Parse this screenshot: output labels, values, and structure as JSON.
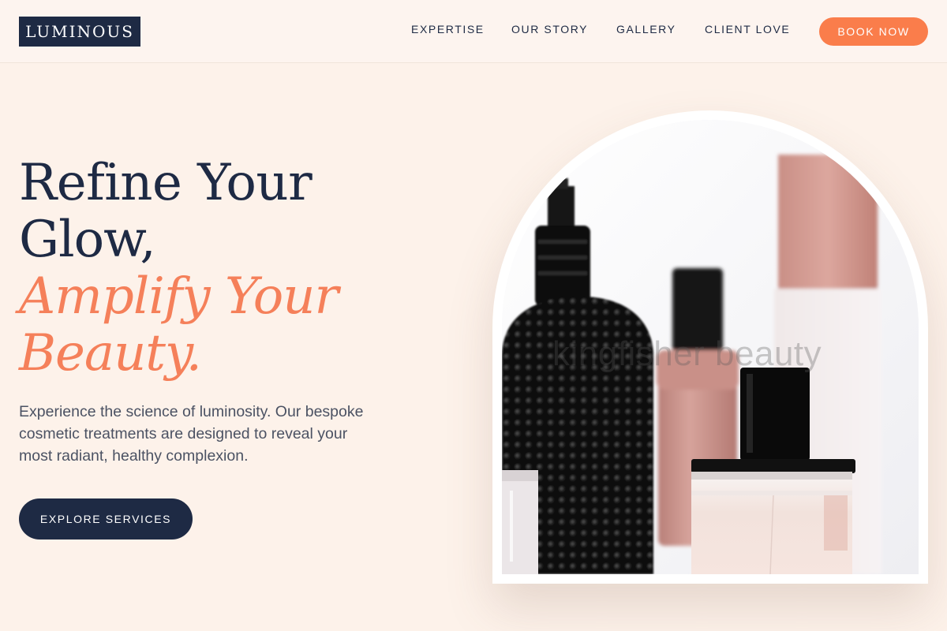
{
  "header": {
    "logo": "LUMINOUS",
    "nav": [
      "EXPERTISE",
      "OUR STORY",
      "GALLERY",
      "CLIENT LOVE"
    ],
    "cta": "BOOK NOW"
  },
  "hero": {
    "headline_line1": "Refine Your",
    "headline_line2": "Glow,",
    "headline_accent1": "Amplify Your",
    "headline_accent2": "Beauty.",
    "description": "Experience the science of luminosity. Our bespoke cosmetic treatments are designed to reveal your most radiant, healthy complexion.",
    "cta": "EXPLORE SERVICES"
  },
  "image": {
    "watermark": "kingfisher beauty"
  },
  "colors": {
    "page_background": "#fdf2ea",
    "navy": "#1e2a44",
    "accent": "#fa7d4b",
    "accent_text": "#f5805a",
    "body_text": "#4b5263"
  }
}
